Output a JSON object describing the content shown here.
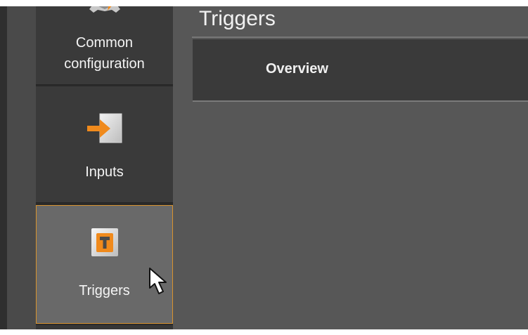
{
  "sidebar": {
    "items": [
      {
        "label_line_1": "Common",
        "label_line_2": "configuration",
        "icon": "gear-icon"
      },
      {
        "label": "Inputs",
        "icon": "arrow-input-icon"
      },
      {
        "label": "Triggers",
        "icon": "trigger-icon",
        "selected": true
      }
    ]
  },
  "main": {
    "page_title": "Triggers",
    "tabs": [
      {
        "label": "Overview"
      }
    ]
  },
  "cursor": {
    "icon": "mouse-pointer-icon"
  },
  "colors": {
    "accent": "#f08a1c",
    "selected_border": "#d8932e",
    "sidebar_background": "#3a3a3a",
    "selected_background": "#696969",
    "content_background": "#575757",
    "tab_background": "#3a3a3a"
  }
}
